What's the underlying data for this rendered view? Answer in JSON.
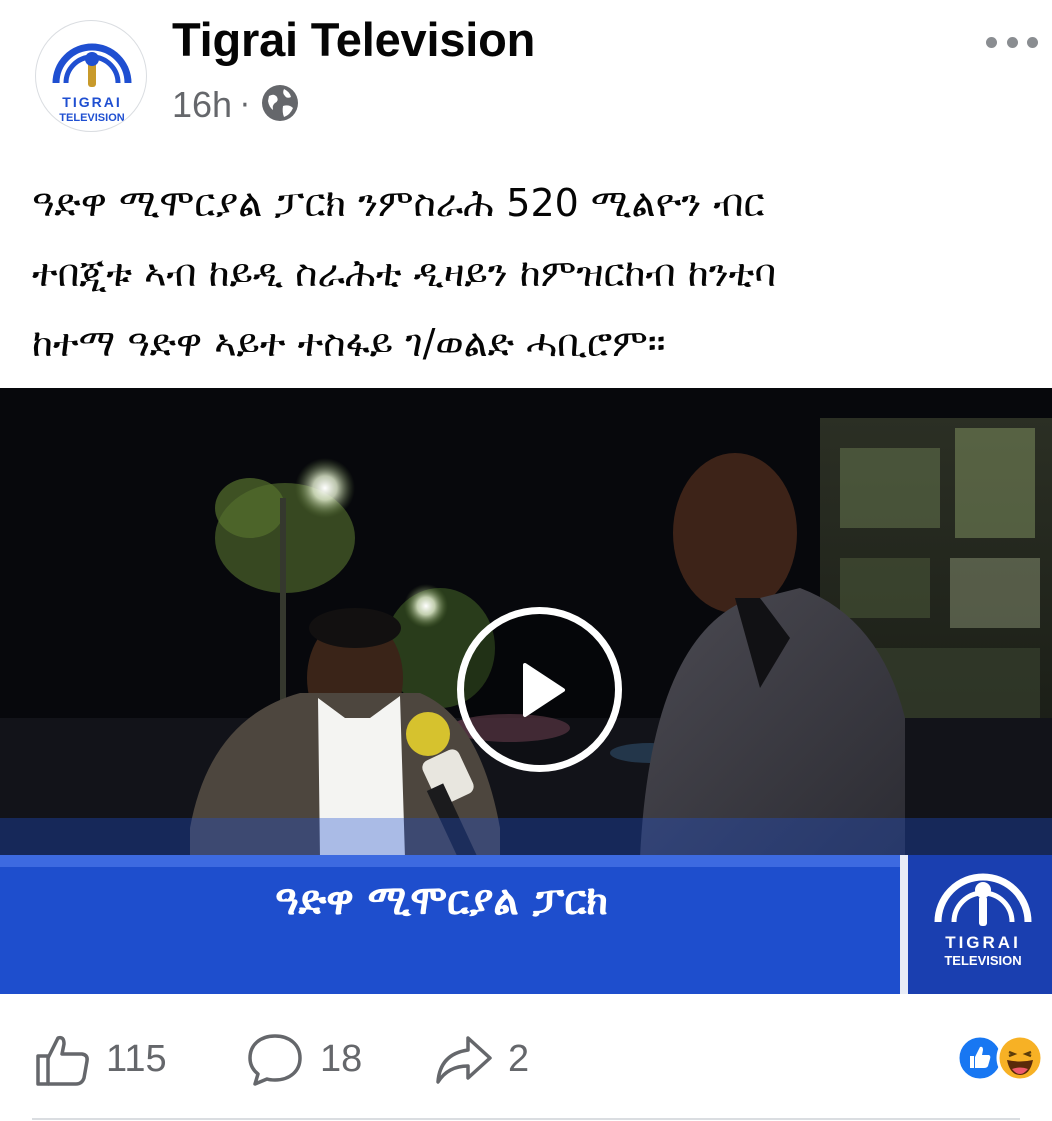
{
  "post": {
    "page_name": "Tigrai Television",
    "timestamp": "16h",
    "separator": "·",
    "privacy_icon": "globe-icon",
    "more_icon": "ellipsis-icon",
    "caption_lines": [
      "ዓድዋ ሚሞርያል ፓርክ ንምስራሕ 520 ሚልዮን ብር",
      "ተበጂቱ ኣብ ከይዲ ስራሕቲ ዲዛይን ከምዝርከብ ከንቲባ",
      "ከተማ ዓድዋ ኣይተ ተስፋይ ገ/ወልድ ሓቢሮም።"
    ]
  },
  "logo": {
    "line1": "TIGRAI",
    "line2": "TELEVISION"
  },
  "video": {
    "lower_third": "ዓድዋ ሚሞርያል ፓርክ",
    "bug_line1": "TIGRAI",
    "bug_line2": "TELEVISION",
    "play_icon": "play-icon"
  },
  "actions": {
    "like_count": "115",
    "comment_count": "18",
    "share_count": "2"
  },
  "reactions": [
    "like-reaction-icon",
    "haha-reaction-icon"
  ],
  "colors": {
    "brand_blue": "#1f4fd1",
    "secondary_text": "#65676b",
    "reaction_blue": "#1877f2"
  }
}
